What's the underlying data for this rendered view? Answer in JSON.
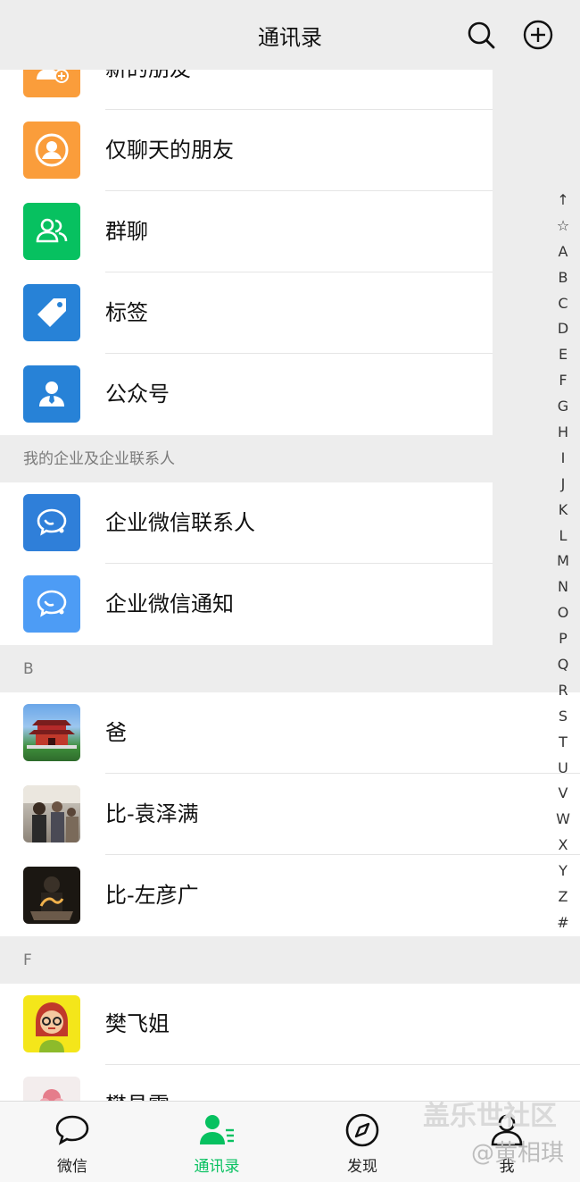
{
  "header": {
    "title": "通讯录"
  },
  "features": [
    {
      "label": "新的朋友",
      "icon": "new-friend-icon",
      "color": "#fa9d3b"
    },
    {
      "label": "仅聊天的朋友",
      "icon": "chat-only-friend-icon",
      "color": "#fa9d3b"
    },
    {
      "label": "群聊",
      "icon": "group-chat-icon",
      "color": "#07c160"
    },
    {
      "label": "标签",
      "icon": "tag-icon",
      "color": "#2782d7"
    },
    {
      "label": "公众号",
      "icon": "official-account-icon",
      "color": "#2782d7"
    }
  ],
  "enterprise": {
    "section_title": "我的企业及企业联系人",
    "items": [
      {
        "label": "企业微信联系人",
        "icon": "wecom-contacts-icon",
        "color": "#2f7fd9"
      },
      {
        "label": "企业微信通知",
        "icon": "wecom-notice-icon",
        "color": "#4d9cf5"
      }
    ]
  },
  "groups": [
    {
      "letter": "B",
      "contacts": [
        {
          "name": "爸",
          "avatar": "pavilion-avatar"
        },
        {
          "name": "比-袁泽满",
          "avatar": "people-avatar"
        },
        {
          "name": "比-左彦广",
          "avatar": "dark-avatar"
        }
      ]
    },
    {
      "letter": "F",
      "contacts": [
        {
          "name": "樊飞姐",
          "avatar": "cartoon-girl-avatar"
        },
        {
          "name": "樊昌需",
          "avatar": "flower-avatar"
        }
      ]
    }
  ],
  "index": [
    "↑",
    "☆",
    "A",
    "B",
    "C",
    "D",
    "E",
    "F",
    "G",
    "H",
    "I",
    "J",
    "K",
    "L",
    "M",
    "N",
    "O",
    "P",
    "Q",
    "R",
    "S",
    "T",
    "U",
    "V",
    "W",
    "X",
    "Y",
    "Z",
    "#"
  ],
  "tabs": [
    {
      "label": "微信",
      "icon": "chat-bubble-icon",
      "active": false
    },
    {
      "label": "通讯录",
      "icon": "contacts-icon",
      "active": true
    },
    {
      "label": "发现",
      "icon": "compass-icon",
      "active": false
    },
    {
      "label": "我",
      "icon": "person-icon",
      "active": false
    }
  ],
  "watermark": {
    "line1": "盖乐世社区",
    "line2": "@黄相琪"
  },
  "colors": {
    "accent": "#07c160",
    "background": "#ededed"
  }
}
